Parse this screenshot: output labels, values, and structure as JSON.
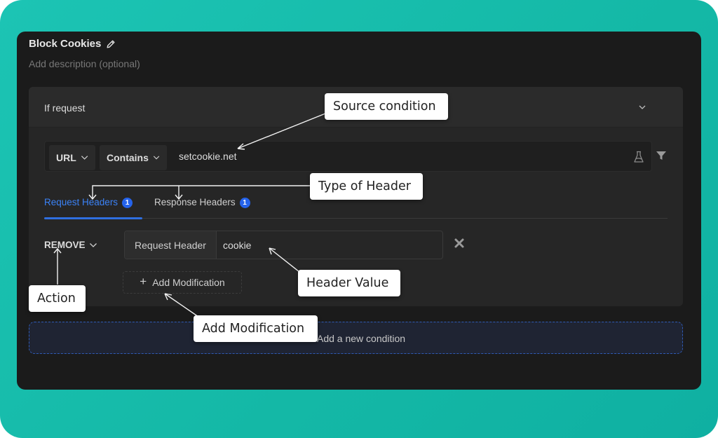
{
  "rule": {
    "title": "Block Cookies",
    "description_placeholder": "Add description (optional)"
  },
  "condition": {
    "header_label": "If request",
    "source_key": "URL",
    "source_operator": "Contains",
    "source_value": "setcookie.net"
  },
  "tabs": [
    {
      "label": "Request Headers",
      "count": "1",
      "active": true
    },
    {
      "label": "Response Headers",
      "count": "1",
      "active": false
    }
  ],
  "modification": {
    "action": "REMOVE",
    "header_type_label": "Request Header",
    "header_value": "cookie",
    "add_modification_label": "Add Modification"
  },
  "add_condition_label": "Add a new condition",
  "annotations": {
    "source_condition": "Source condition",
    "type_of_header": "Type of Header",
    "header_value": "Header Value",
    "action": "Action",
    "add_modification": "Add Modification"
  },
  "colors": {
    "accent": "#3b82f6",
    "frame": "#14b8a6",
    "panel": "#1b1b1b"
  }
}
